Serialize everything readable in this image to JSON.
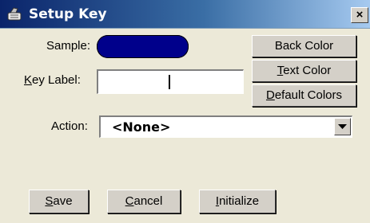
{
  "window": {
    "title": "Setup Key",
    "close_glyph": "×",
    "icon": "key-icon"
  },
  "colors": {
    "sample_back": "#00008b",
    "dialog_bg": "#ece9d8",
    "titlebar": "#0a246a"
  },
  "sample": {
    "label": "Sample:"
  },
  "key_label": {
    "label_underline": "K",
    "label_rest": "ey Label:",
    "value": ""
  },
  "buttons": {
    "back_color": "Back Color",
    "text_color_u": "T",
    "text_color_rest": "ext Color",
    "default_colors_u": "D",
    "default_colors_rest": "efault Colors",
    "save_u": "S",
    "save_rest": "ave",
    "cancel_u": "C",
    "cancel_rest": "ancel",
    "initialize_u": "I",
    "initialize_rest": "nitialize"
  },
  "action": {
    "label": "Action:",
    "selected": "<None>"
  }
}
